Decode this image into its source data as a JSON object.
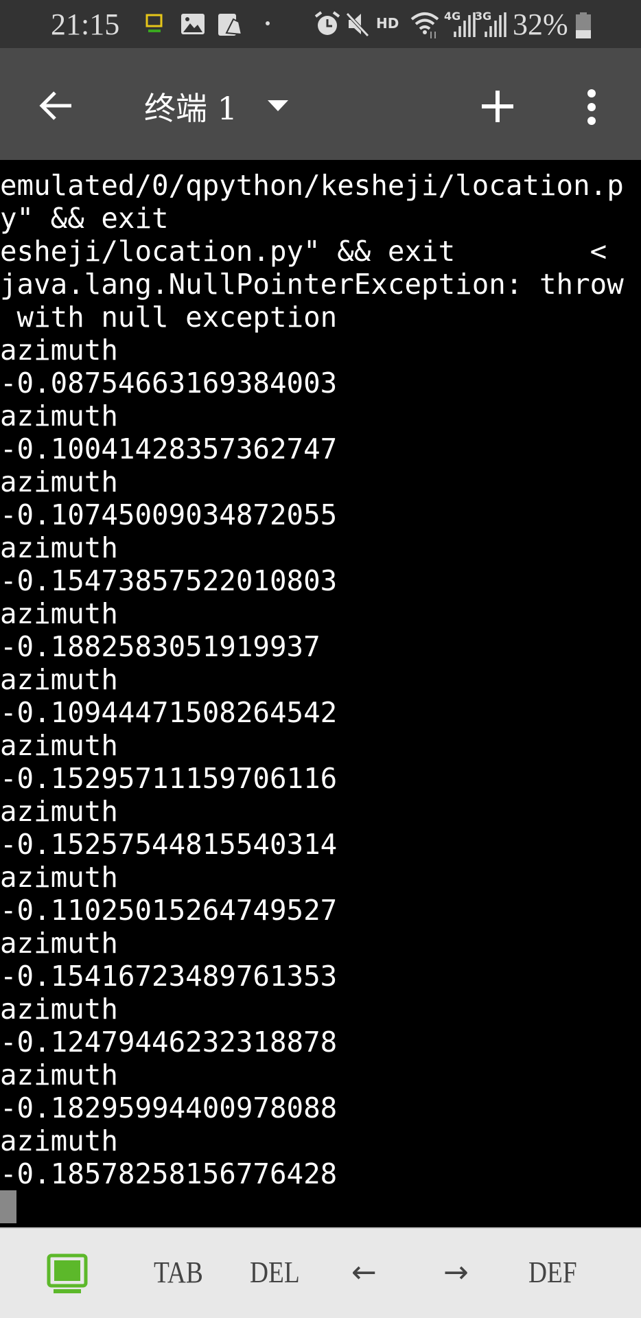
{
  "status_bar": {
    "time": "21:15",
    "hd_label": "HD",
    "net1": "4G",
    "net2": "3G",
    "battery": "32%",
    "battery_level": 0.32,
    "icons": [
      "screen-icon",
      "gallery-icon",
      "edit-icon",
      "dot-icon",
      "alarm-icon",
      "mute-icon",
      "wifi-icon",
      "signal-icon",
      "battery-icon"
    ]
  },
  "app_bar": {
    "title": "终端 1",
    "icons": [
      "back-arrow-icon",
      "dropdown-triangle-icon",
      "plus-icon",
      "more-vert-icon"
    ]
  },
  "terminal": {
    "lines": [
      "emulated/0/qpython/kesheji/location.p",
      "y\" && exit",
      "esheji/location.py\" && exit        <",
      "java.lang.NullPointerException: throw",
      " with null exception",
      "azimuth",
      "-0.08754663169384003",
      "azimuth",
      "-0.10041428357362747",
      "azimuth",
      "-0.10745009034872055",
      "azimuth",
      "-0.15473857522010803",
      "azimuth",
      "-0.1882583051919937",
      "azimuth",
      "-0.10944471508264542",
      "azimuth",
      "-0.15295711159706116",
      "azimuth",
      "-0.15257544815540314",
      "azimuth",
      "-0.11025015264749527",
      "azimuth",
      "-0.15416723489761353",
      "azimuth",
      "-0.12479446232318878",
      "azimuth",
      "-0.18295994400978088",
      "azimuth",
      "-0.18578258156776428"
    ]
  },
  "extra_keys": {
    "keyboard_icon_color": "#5cb82a",
    "tab": "TAB",
    "del": "DEL",
    "left": "←",
    "right": "→",
    "def": "DEF"
  }
}
